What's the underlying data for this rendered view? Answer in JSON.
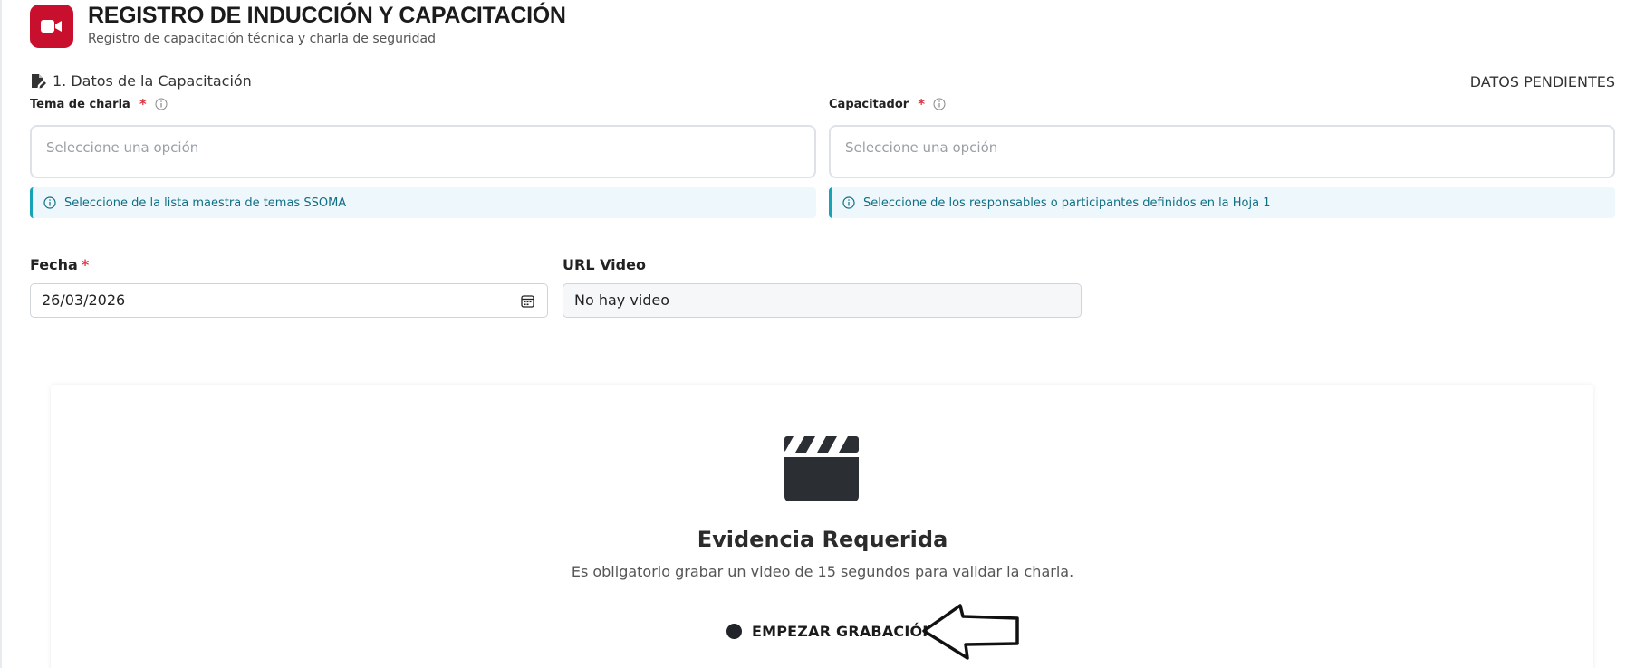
{
  "header": {
    "title": "REGISTRO DE INDUCCIÓN Y CAPACITACIÓN",
    "subtitle": "Registro de capacitación técnica y charla de seguridad",
    "icon": "video-camera-icon",
    "accent_color": "#c8102e"
  },
  "section": {
    "title": "1. Datos de la Capacitación",
    "status": "DATOS PENDIENTES"
  },
  "fields": {
    "tema": {
      "label": "Tema de charla",
      "required_mark": "*",
      "placeholder": "Seleccione una opción",
      "hint": "Seleccione de la lista maestra de temas SSOMA"
    },
    "capacitador": {
      "label": "Capacitador",
      "required_mark": "*",
      "placeholder": "Seleccione una opción",
      "hint": "Seleccione de los responsables o participantes definidos en la Hoja 1"
    },
    "fecha": {
      "label": "Fecha",
      "required_mark": "*",
      "value": "26/03/2026"
    },
    "url_video": {
      "label": "URL Video",
      "value": "No hay video"
    }
  },
  "evidence": {
    "icon": "clapperboard-icon",
    "title": "Evidencia Requerida",
    "description": "Es obligatorio grabar un video de 15 segundos para validar la charla.",
    "record_button": "EMPEZAR GRABACIÓN"
  }
}
